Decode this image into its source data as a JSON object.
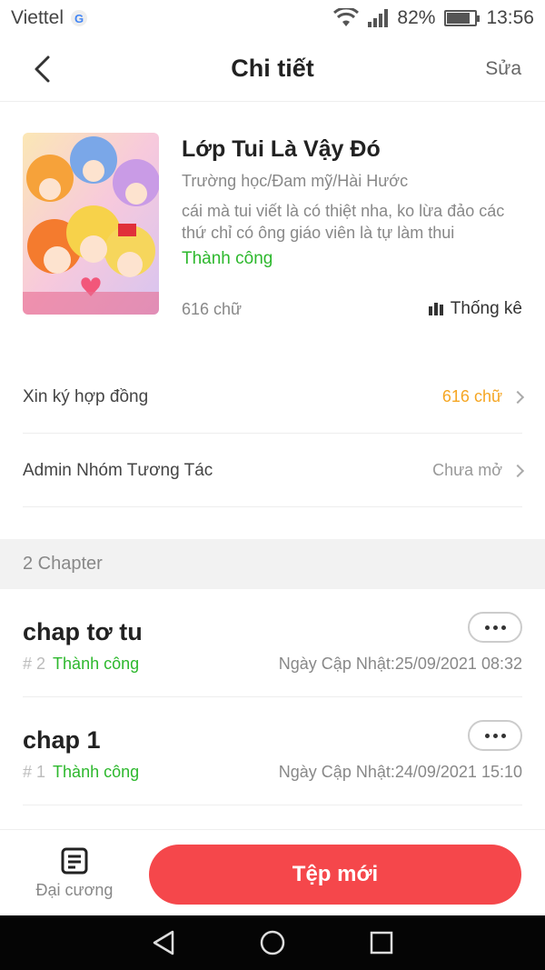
{
  "status_bar": {
    "carrier": "Viettel",
    "carrier_badge": "G",
    "battery": "82%",
    "time": "13:56",
    "battery_level": 0.82
  },
  "header": {
    "title": "Chi tiết",
    "edit_label": "Sửa"
  },
  "book": {
    "title": "Lớp Tui Là Vậy Đó",
    "genre": "Trường học/Đam mỹ/Hài Hước",
    "description": "cái mà tui viết là có thiệt nha, ko lừa đảo các thứ chỉ có ông giáo viên là tự làm thui",
    "status": "Thành công",
    "word_count": "616 chữ",
    "stats_label": "Thống kê"
  },
  "rows": [
    {
      "label": "Xin ký hợp đồng",
      "value": "616 chữ",
      "value_color": "#f5a623"
    },
    {
      "label": "Admin Nhóm Tương Tác",
      "value": "Chưa mở",
      "value_color": "#999999"
    }
  ],
  "chapters_section": {
    "label": "2 Chapter"
  },
  "chapters": [
    {
      "title": "chap tơ tu",
      "hash": "#",
      "number": "2",
      "status": "Thành công",
      "date_label": "Ngày Cập Nhật:",
      "date": "25/09/2021 08:32"
    },
    {
      "title": "chap 1",
      "hash": "#",
      "number": "1",
      "status": "Thành công",
      "date_label": "Ngày Cập Nhật:",
      "date": "24/09/2021 15:10"
    }
  ],
  "bottom_bar": {
    "outline_label": "Đại cương",
    "new_button_label": "Tệp mới"
  },
  "colors": {
    "accent_red": "#f5474b",
    "success_green": "#2db82d",
    "orange": "#f5a623"
  }
}
